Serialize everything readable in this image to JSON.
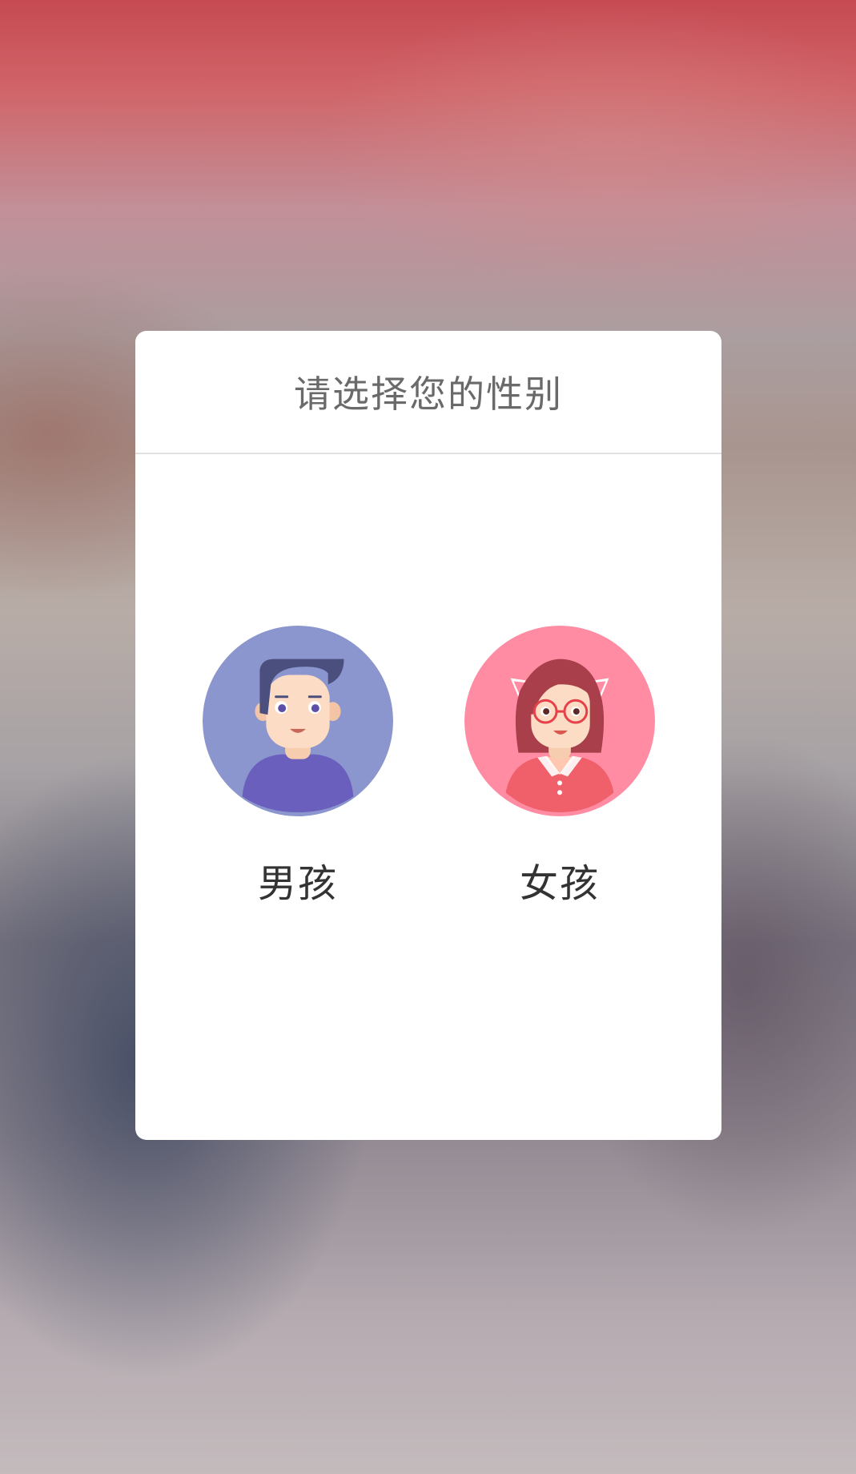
{
  "dialog": {
    "title": "请选择您的性别"
  },
  "options": [
    {
      "label": "男孩",
      "avatar_icon": "boy-avatar-icon",
      "color": "#8a96cd"
    },
    {
      "label": "女孩",
      "avatar_icon": "girl-avatar-icon",
      "color": "#ff8ca3"
    }
  ]
}
